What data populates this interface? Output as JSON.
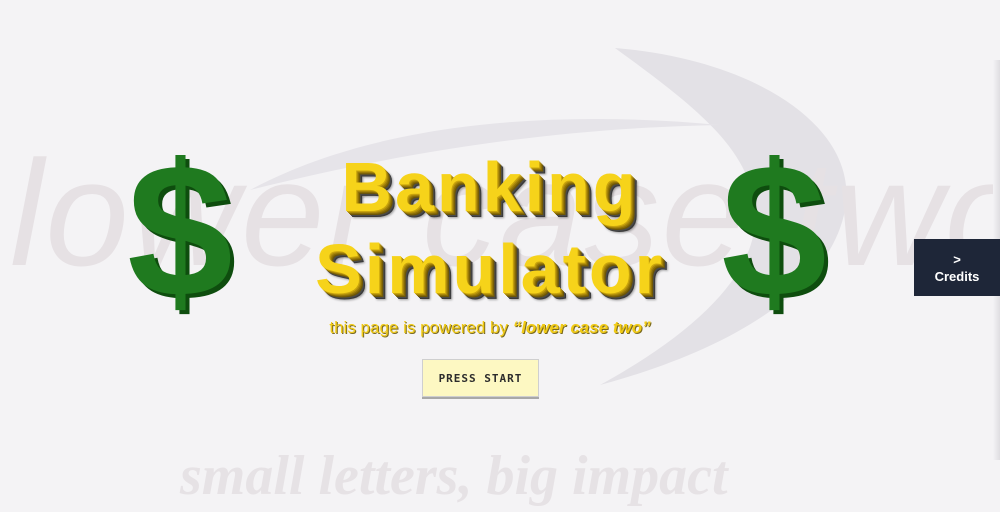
{
  "background": {
    "wordmark": "lower case two",
    "tagline": "small letters, big impact"
  },
  "title": {
    "line1": "Banking",
    "line2": "Simulator",
    "color": "#f6d31a"
  },
  "dollar_sign": "$",
  "powered_by": {
    "prefix": "this page is powered by ",
    "brand": "“lower case two”"
  },
  "buttons": {
    "press_start": "PRESS START",
    "credits_arrow": ">",
    "credits_label": "Credits"
  },
  "colors": {
    "background": "#f4f3f5",
    "dollar_green": "#1f7a1f",
    "button_yellow": "#fdf8c2",
    "credits_navy": "#1e2638"
  }
}
